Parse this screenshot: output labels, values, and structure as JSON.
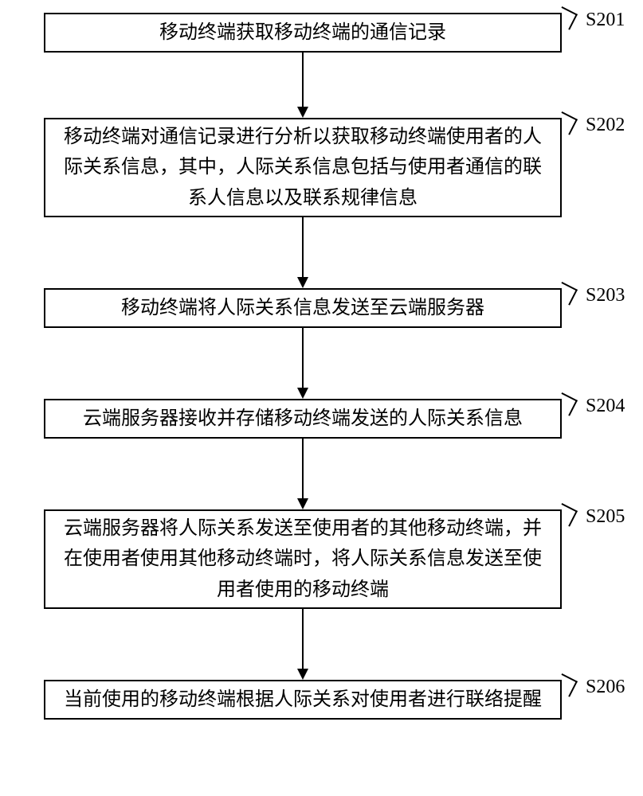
{
  "flow": {
    "steps": [
      {
        "id": "S201",
        "text": "移动终端获取移动终端的通信记录"
      },
      {
        "id": "S202",
        "text": "移动终端对通信记录进行分析以获取移动终端使用者的人际关系信息，其中，人际关系信息包括与使用者通信的联系人信息以及联系规律信息"
      },
      {
        "id": "S203",
        "text": "移动终端将人际关系信息发送至云端服务器"
      },
      {
        "id": "S204",
        "text": "云端服务器接收并存储移动终端发送的人际关系信息"
      },
      {
        "id": "S205",
        "text": "云端服务器将人际关系发送至使用者的其他移动终端，并在使用者使用其他移动终端时，将人际关系信息发送至使用者使用的移动终端"
      },
      {
        "id": "S206",
        "text": "当前使用的移动终端根据人际关系对使用者进行联络提醒"
      }
    ]
  }
}
